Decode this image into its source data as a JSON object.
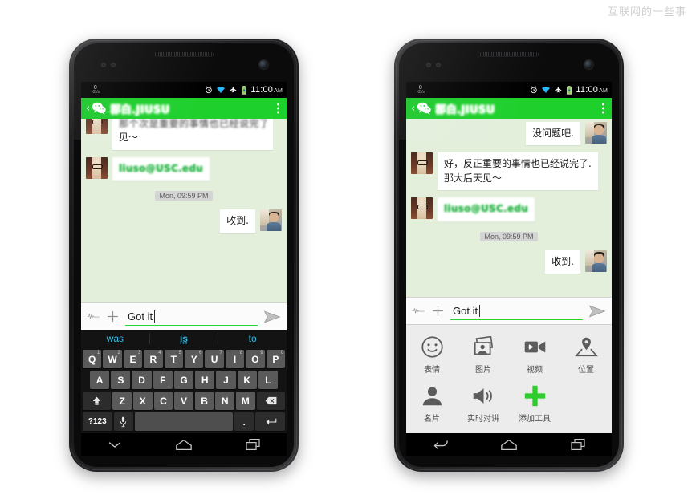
{
  "watermark": "互联网的一些事",
  "statusbar": {
    "net_speed_value": "0",
    "net_speed_unit": "KB/s",
    "icons": [
      "alarm-icon",
      "wifi-icon",
      "airplane-icon",
      "battery-icon"
    ],
    "time": "11:00",
    "ampm": "AM"
  },
  "titlebar": {
    "back": "‹",
    "logo": "wechat-logo",
    "title": "郡白.JIUSU",
    "menu": "overflow-menu"
  },
  "input": {
    "voice_icon": "voice-waveform-icon",
    "plus_icon": "plus-icon",
    "value": "Got it",
    "placeholder": "",
    "send_icon": "send-arrow-icon"
  },
  "left_phone": {
    "messages": [
      {
        "side": "incoming",
        "avatar": "her",
        "clipped": true,
        "line_blurred": "那个次是重要的事情也已经说完了那大后天",
        "text": "见～"
      },
      {
        "side": "incoming",
        "avatar": "her",
        "link": true,
        "text": "liuso@USC.edu"
      }
    ],
    "timestamp": "Mon, 09:59 PM",
    "reply": {
      "side": "outgoing",
      "avatar": "him",
      "text": "收到."
    },
    "keyboard": {
      "suggestions": [
        "was",
        "is",
        "to"
      ],
      "row1": [
        {
          "label": "Q",
          "sup": "1"
        },
        {
          "label": "W",
          "sup": "2"
        },
        {
          "label": "E",
          "sup": "3"
        },
        {
          "label": "R",
          "sup": "4"
        },
        {
          "label": "T",
          "sup": "5"
        },
        {
          "label": "Y",
          "sup": "6"
        },
        {
          "label": "U",
          "sup": "7"
        },
        {
          "label": "I",
          "sup": "8"
        },
        {
          "label": "O",
          "sup": "9"
        },
        {
          "label": "P",
          "sup": "0"
        }
      ],
      "row2": [
        "A",
        "S",
        "D",
        "F",
        "G",
        "H",
        "J",
        "K",
        "L"
      ],
      "row3_letters": [
        "Z",
        "X",
        "C",
        "V",
        "B",
        "N",
        "M"
      ],
      "shift_key": "shift-icon",
      "backspace_key": "backspace-icon",
      "symbols_key": "?123",
      "mic_key": "microphone-icon",
      "space_key": "",
      "period_key": ".",
      "enter_key": "enter-icon"
    },
    "navbar": [
      "hide-keyboard-icon",
      "home-icon",
      "recents-icon"
    ]
  },
  "right_phone": {
    "messages": [
      {
        "side": "outgoing",
        "avatar": "him",
        "text": "没问题吧."
      },
      {
        "side": "incoming",
        "avatar": "her",
        "text": "好，反正重要的事情也已经说完了.\n那大后天见～"
      },
      {
        "side": "incoming",
        "avatar": "her",
        "link": true,
        "text": "liuso@USC.edu"
      }
    ],
    "timestamp": "Mon, 09:59 PM",
    "reply": {
      "side": "outgoing",
      "avatar": "him",
      "text": "收到."
    },
    "attachments": [
      [
        {
          "icon": "smiley-icon",
          "label": "表情"
        },
        {
          "icon": "photos-icon",
          "label": "图片"
        },
        {
          "icon": "video-camera-icon",
          "label": "视频"
        },
        {
          "icon": "location-pin-icon",
          "label": "位置"
        }
      ],
      [
        {
          "icon": "contact-card-icon",
          "label": "名片"
        },
        {
          "icon": "walkie-talkie-icon",
          "label": "实时对讲"
        },
        {
          "icon": "add-tools-plus-icon",
          "label": "添加工具"
        }
      ]
    ],
    "navbar": [
      "back-icon",
      "home-icon",
      "recents-icon"
    ]
  },
  "colors": {
    "header_green": "#1ed02c",
    "chat_bg": "#e3eedb",
    "accent_green": "#27d62f",
    "link_green": "#2ab24a",
    "status_bg": "#000000"
  }
}
